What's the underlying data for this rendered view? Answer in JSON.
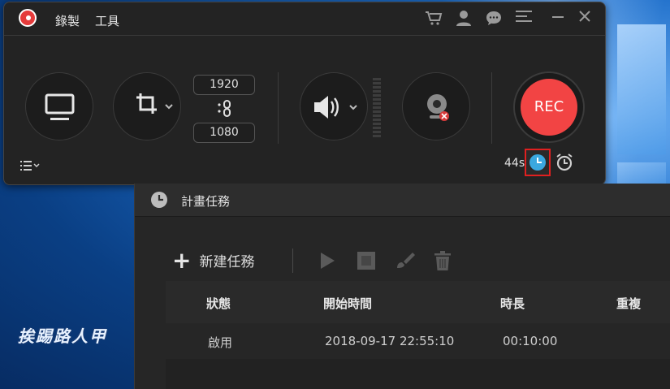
{
  "watermark": "挨踢路人甲",
  "recorder": {
    "menu": [
      "錄製",
      "工具"
    ],
    "icons": [
      "cart-icon",
      "user-icon",
      "chat-icon",
      "menu-icon",
      "minimize-icon",
      "close-icon"
    ],
    "width_value": "1920",
    "height_value": "1080",
    "rec_label": "REC",
    "timer": "44s",
    "accent": "#f24444"
  },
  "schedule": {
    "title": "計畫任務",
    "new_task": "新建任務",
    "columns": [
      "狀態",
      "開始時間",
      "時長",
      "重複"
    ],
    "rows": [
      {
        "status": "啟用",
        "start": "2018-09-17 22:55:10",
        "duration": "00:10:00",
        "repeat": ""
      }
    ]
  }
}
